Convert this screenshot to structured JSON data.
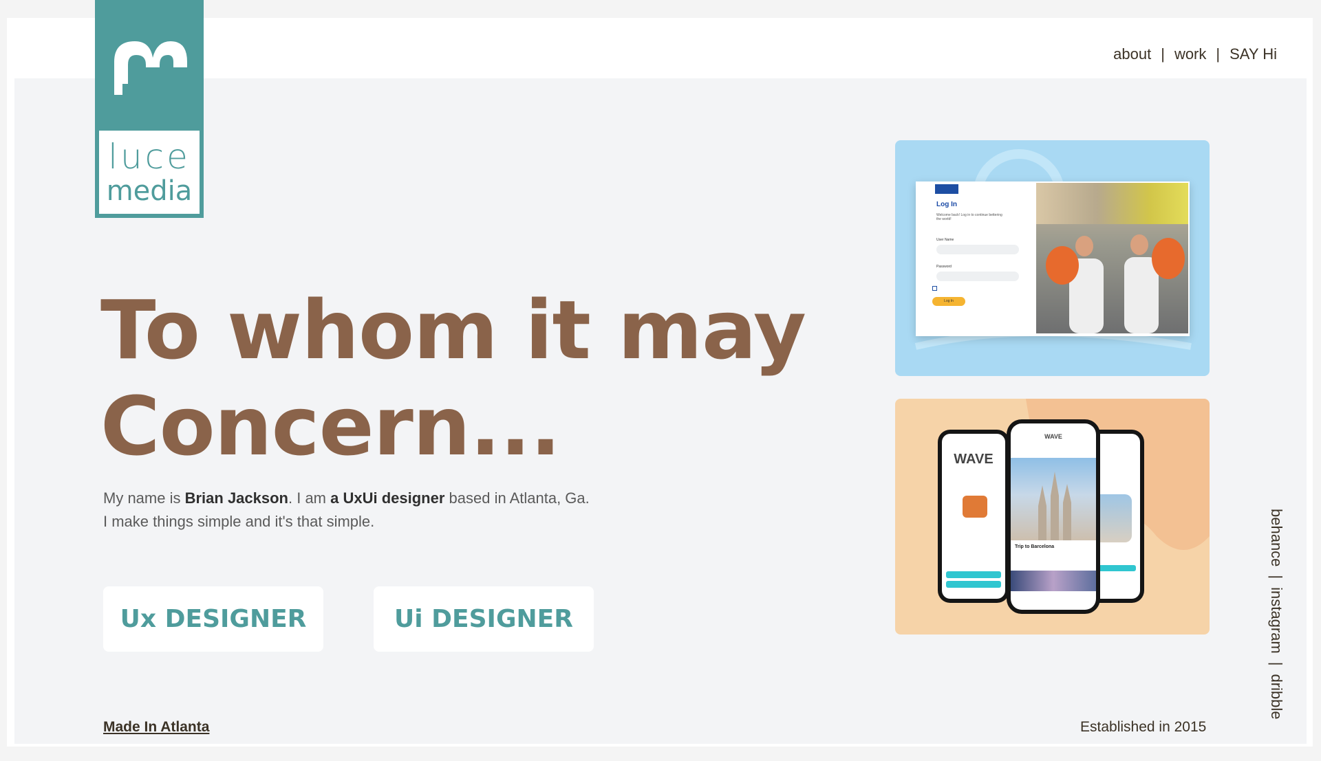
{
  "logo": {
    "line1": "luce",
    "line2": "media"
  },
  "nav": {
    "about": "about",
    "work": "work",
    "say_hi": "SAY Hi",
    "separator": "|"
  },
  "hero": {
    "headline_line1": "To whom it may",
    "headline_line2": "Concern...",
    "intro_prefix": "My name is ",
    "intro_name": "Brian Jackson",
    "intro_mid": ". I am ",
    "intro_role": "a UxUi designer",
    "intro_suffix": " based in Atlanta, Ga.",
    "intro_line2": "I make things simple and it's that simple."
  },
  "buttons": {
    "ux": "Ux DESIGNER",
    "ui": "Ui DESIGNER"
  },
  "footer": {
    "made_in": "Made In Atlanta",
    "established": "Established in 2015"
  },
  "social": {
    "behance": "behance",
    "instagram": "instagram",
    "dribble": "dribble",
    "separator": "|"
  },
  "card_login": {
    "title": "Log In",
    "welcome": "Welcome back! Log in to continue bettering the world!",
    "user_label": "User Name",
    "password_label": "Password",
    "button": "Log In"
  },
  "card_wave": {
    "brand": "WAVE",
    "trip": "Trip to Barcelona"
  },
  "colors": {
    "teal": "#4f9c9c",
    "brown": "#8a634a",
    "light_blue": "#a9d9f3",
    "peach": "#f6d3a8"
  }
}
